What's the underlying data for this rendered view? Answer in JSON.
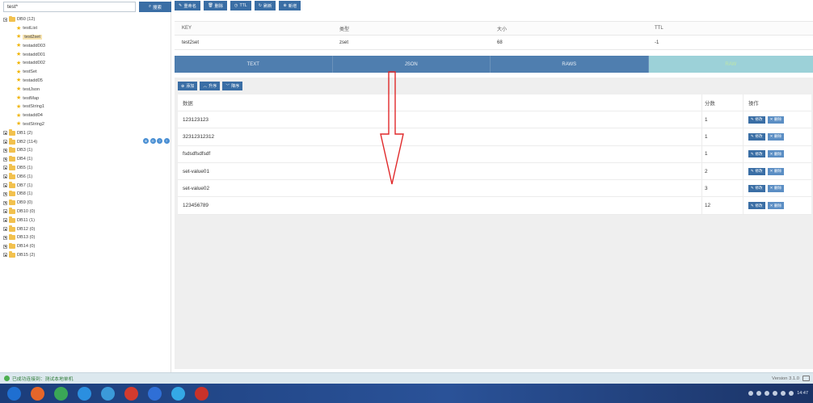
{
  "search": {
    "value": "test*",
    "button_label": "搜索"
  },
  "toolbar": {
    "rename": "重命名",
    "delete": "删除",
    "ttl": "TTL",
    "refresh": "刷新",
    "add": "新增"
  },
  "tree": {
    "db0": {
      "label": "DB0 (12)",
      "tools": [
        "⊕",
        "⊖",
        "?",
        "?"
      ]
    },
    "keys": [
      {
        "label": "testList",
        "selected": false
      },
      {
        "label": "test2set",
        "selected": true
      },
      {
        "label": "testadd003",
        "selected": false
      },
      {
        "label": "testadd001",
        "selected": false
      },
      {
        "label": "testadd002",
        "selected": false
      },
      {
        "label": "testSet",
        "selected": false
      },
      {
        "label": "testadd05",
        "selected": false
      },
      {
        "label": "testJson",
        "selected": false
      },
      {
        "label": "testMap",
        "selected": false
      },
      {
        "label": "testString1",
        "selected": false
      },
      {
        "label": "testadd04",
        "selected": false
      },
      {
        "label": "testString2",
        "selected": false
      }
    ],
    "dbs": [
      "DB1 (2)",
      "DB2 (114)",
      "DB3 (1)",
      "DB4 (1)",
      "DB5 (1)",
      "DB6 (1)",
      "DB7 (1)",
      "DB8 (1)",
      "DB9 (0)",
      "DB10 (0)",
      "DB11 (1)",
      "DB12 (0)",
      "DB13 (0)",
      "DB14 (0)",
      "DB15 (2)"
    ]
  },
  "keyinfo": {
    "headers": [
      "KEY",
      "类型",
      "大小",
      "TTL"
    ],
    "values": [
      "test2set",
      "zset",
      "68",
      "-1"
    ]
  },
  "tabs": [
    "TEXT",
    "JSON",
    "RAWS",
    "RAW"
  ],
  "actions": {
    "add": "添加",
    "asc": "升序",
    "desc": "降序"
  },
  "table": {
    "headers": {
      "data": "数据",
      "score": "分数",
      "ops": "操作"
    },
    "edit_label": "修改",
    "delete_label": "删除",
    "rows": [
      {
        "value": "123123123",
        "score": "1"
      },
      {
        "value": "32312312312",
        "score": "1"
      },
      {
        "value": "fsdsdfsdfsdf",
        "score": "1"
      },
      {
        "value": "set-value01",
        "score": "2"
      },
      {
        "value": "set-value02",
        "score": "3"
      },
      {
        "value": "123456789",
        "score": "12"
      }
    ]
  },
  "status": {
    "text": "已成功连接到：测试本地单机",
    "version": "Version 3.1.0"
  },
  "taskbar": {
    "apps": [
      {
        "icon": "windows-start-icon",
        "color": "#1f6fd1"
      },
      {
        "icon": "firefox-icon",
        "color": "#e5662a"
      },
      {
        "icon": "chrome-icon",
        "color": "#3aa757"
      },
      {
        "icon": "browser-icon",
        "color": "#2b8fe0"
      },
      {
        "icon": "app-icon",
        "color": "#3b9ad9"
      },
      {
        "icon": "app-icon-red",
        "color": "#d23b2e"
      },
      {
        "icon": "app-icon-blue",
        "color": "#2f6fd6"
      },
      {
        "icon": "app-icon-cyan",
        "color": "#34a8e6"
      },
      {
        "icon": "redis-icon",
        "color": "#c8322a"
      }
    ],
    "clock": "14:47"
  },
  "colors": {
    "accent": "#3a6ea5",
    "tab_bar": "#4f7eaf",
    "tab_active": "#9cd1d8",
    "arrow": "#e0292a"
  }
}
